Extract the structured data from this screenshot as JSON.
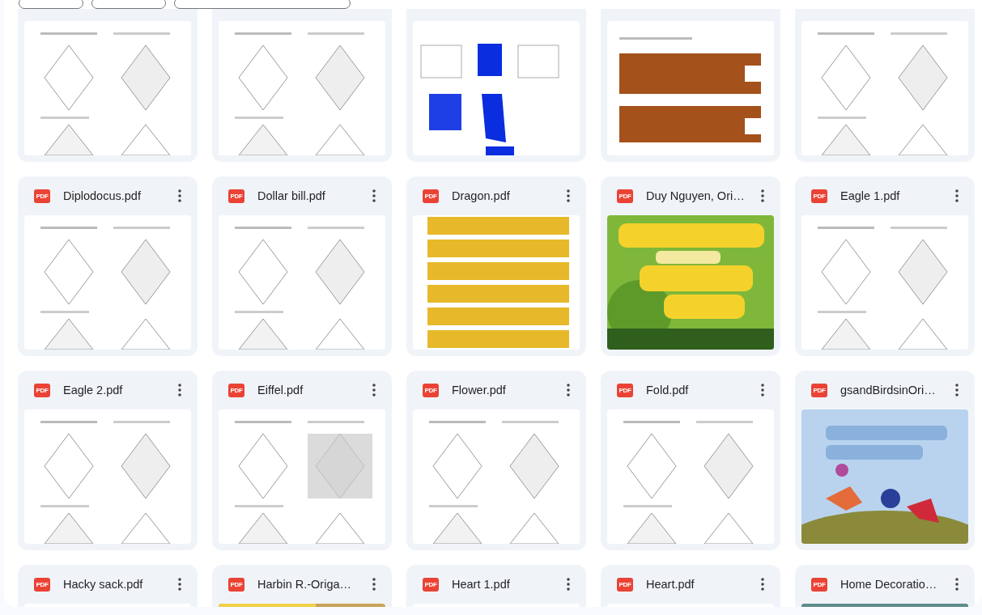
{
  "files": [
    {
      "kind": "picture"
    },
    {
      "kind": "picture"
    },
    {
      "kind": "picture"
    },
    {
      "kind": "picture"
    },
    {
      "kind": "picture"
    },
    {
      "name": "Diplodocus.pdf",
      "icon_label": "PDF",
      "kind": "picture"
    },
    {
      "name": "Dollar bill.pdf",
      "icon_label": "PDF",
      "kind": "picture"
    },
    {
      "name": "Dragon.pdf",
      "icon_label": "PDF",
      "kind": "picture"
    },
    {
      "name": "Duy Nguyen, Ori…",
      "icon_label": "PDF",
      "kind": "picture"
    },
    {
      "name": "Eagle 1.pdf",
      "icon_label": "PDF",
      "kind": "picture"
    },
    {
      "name": "Eagle 2.pdf",
      "icon_label": "PDF",
      "kind": "picture"
    },
    {
      "name": "Eiffel.pdf",
      "icon_label": "PDF",
      "kind": "picture"
    },
    {
      "name": "Flower.pdf",
      "icon_label": "PDF",
      "kind": "picture"
    },
    {
      "name": "Fold.pdf",
      "icon_label": "PDF",
      "kind": "picture"
    },
    {
      "name": "gsandBirdsinOri…",
      "icon_label": "PDF",
      "kind": "picture"
    },
    {
      "name": "Hacky sack.pdf",
      "icon_label": "PDF",
      "kind": "picture"
    },
    {
      "name": "Harbin R.-Origa…",
      "icon_label": "PDF",
      "kind": "picture"
    },
    {
      "name": "Heart 1.pdf",
      "icon_label": "PDF",
      "kind": "picture"
    },
    {
      "name": "Heart.pdf",
      "icon_label": "PDF",
      "kind": "picture"
    },
    {
      "name": "Home Decoratio…",
      "icon_label": "PDF",
      "kind": "picture"
    }
  ]
}
